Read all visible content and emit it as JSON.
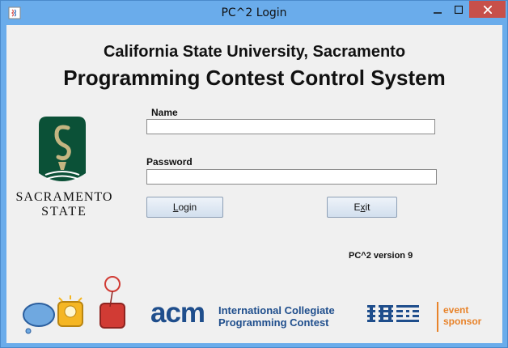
{
  "window": {
    "title": "PC^2 Login"
  },
  "header": {
    "university": "California State University, Sacramento",
    "system": "Programming Contest Control System"
  },
  "logo": {
    "line1": "SACRAMENTO",
    "line2": "STATE"
  },
  "form": {
    "name_label": "Name",
    "name_value": "",
    "password_label": "Password",
    "password_value": "",
    "login_mnemonic": "L",
    "login_rest": "ogin",
    "exit_first": "E",
    "exit_mnemonic": "x",
    "exit_rest": "it"
  },
  "version": "PC^2 version 9",
  "footer": {
    "acm_word": "acm",
    "acm_line1": "International Collegiate",
    "acm_line2": "Programming Contest",
    "sponsor_line1": "event",
    "sponsor_line2": "sponsor"
  },
  "colors": {
    "acm_blue": "#1f4e8c",
    "sponsor_orange": "#e8832a",
    "sac_green": "#0b5137",
    "sac_gold": "#c4b581"
  },
  "icons": [
    "java-app-icon",
    "minimize-icon",
    "maximize-icon",
    "close-icon"
  ]
}
